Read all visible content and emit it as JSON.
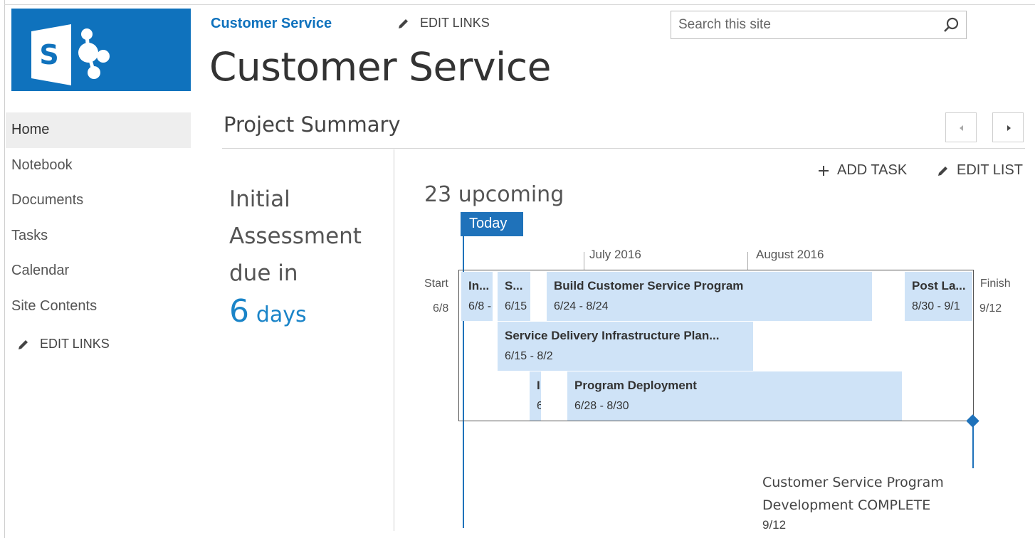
{
  "header": {
    "site_link": "Customer Service",
    "edit_links": "EDIT LINKS",
    "search_placeholder": "Search this site",
    "site_title": "Customer Service",
    "brand_color": "#0f72bd"
  },
  "nav": {
    "items": [
      {
        "label": "Home",
        "active": true
      },
      {
        "label": "Notebook"
      },
      {
        "label": "Documents"
      },
      {
        "label": "Tasks"
      },
      {
        "label": "Calendar"
      },
      {
        "label": "Site Contents"
      }
    ],
    "edit_links": "EDIT LINKS"
  },
  "main": {
    "section_title": "Project Summary",
    "callout": {
      "line1": "Initial",
      "line2": "Assessment",
      "line3": "due in",
      "number": "6",
      "unit": "days"
    },
    "toolbar": {
      "add_task": "ADD TASK",
      "edit_list": "EDIT LIST"
    },
    "upcoming": "23 upcoming",
    "timeline": {
      "today_label": "Today",
      "months": [
        "July 2016",
        "August 2016"
      ],
      "start_label": "Start",
      "start_date": "6/8",
      "finish_label": "Finish",
      "finish_date": "9/12",
      "tasks": [
        {
          "name": "In...",
          "dates": "6/8 -"
        },
        {
          "name": "S...",
          "dates": "6/15"
        },
        {
          "name": "Build Customer Service Program",
          "dates": "6/24 - 8/24"
        },
        {
          "name": "Post La...",
          "dates": "8/30 - 9/1"
        },
        {
          "name": "Service Delivery Infrastructure Plan...",
          "dates": "6/15 - 8/2"
        },
        {
          "name": "I",
          "dates": "6"
        },
        {
          "name": "Program Deployment",
          "dates": "6/28 - 8/30"
        }
      ],
      "milestone": {
        "title": "Customer Service Program Development COMPLETE",
        "date": "9/12"
      },
      "bar_color": "#cfe3f7",
      "accent_color": "#1f72ba"
    }
  }
}
